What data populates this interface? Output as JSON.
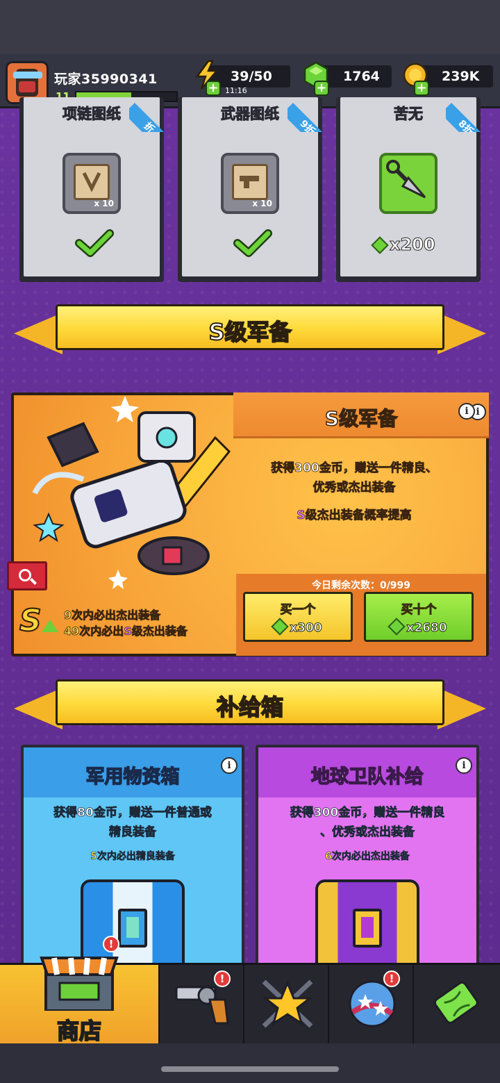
{
  "player": {
    "name": "玩家35990341",
    "level": "11",
    "xp_fraction": 0.55
  },
  "resources": {
    "energy": "39/50",
    "energy_timer": "11:16",
    "gems": "1764",
    "coins": "239K"
  },
  "offers": [
    {
      "title": "项链图纸",
      "qty": "x 10",
      "status": "purchased",
      "discount": "折"
    },
    {
      "title": "武器图纸",
      "qty": "x 10",
      "status": "purchased",
      "discount": "9折"
    },
    {
      "title": "苦无",
      "price": "x200",
      "status": "available",
      "discount": "8折"
    }
  ],
  "s_gear": {
    "banner": "S级军备",
    "title": "S级军备",
    "desc_line1_prefix": "获得300金币，赠送一件",
    "desc_line1_hl": "精良",
    "desc_line1_suffix": "、",
    "desc_line2_hl1": "优秀",
    "desc_line2_mid": "或",
    "desc_line2_hl2": "杰出",
    "desc_line2_suffix": "装备",
    "rate_hl": "S级杰出",
    "rate_suffix": "装备概率提高",
    "remaining": "今日剩余次数：0/999",
    "buy_one_label": "买一个",
    "buy_one_price": "x300",
    "buy_ten_label": "买十个",
    "buy_ten_price": "x2680",
    "pity1_num": "9",
    "pity1_mid": "次内必出",
    "pity1_hl": "杰出",
    "pity1_suffix": "装备",
    "pity2_num": "49",
    "pity2_mid": "次内必出",
    "pity2_hl": "S级杰出",
    "pity2_suffix": "装备",
    "badge": "S"
  },
  "supply": {
    "banner": "补给箱",
    "boxes": [
      {
        "title": "军用物资箱",
        "desc_prefix": "获得80金币，赠送一件普通或",
        "desc_hl": "精良",
        "desc_suffix": "装备",
        "pity_num": "5",
        "pity_mid": "次内必出",
        "pity_hl": "精良",
        "pity_suffix": "装备"
      },
      {
        "title": "地球卫队补给",
        "desc_prefix": "获得300金币，赠送一件",
        "desc_hl1": "精良",
        "desc_mid": "、",
        "desc_hl2": "优秀",
        "desc_mid2": "或",
        "desc_hl3": "杰出",
        "desc_suffix": "装备",
        "pity_num": "6",
        "pity_mid": "次内必出",
        "pity_hl": "杰出",
        "pity_suffix": "装备"
      }
    ]
  },
  "nav": {
    "tabs": [
      {
        "label": "商店",
        "icon": "shop-stall-icon",
        "active": true,
        "alert": true
      },
      {
        "label": "",
        "icon": "revolver-icon",
        "active": false,
        "alert": true
      },
      {
        "label": "",
        "icon": "star-swords-icon",
        "active": false,
        "alert": false
      },
      {
        "label": "",
        "icon": "planet-stars-icon",
        "active": false,
        "alert": true
      },
      {
        "label": "",
        "icon": "dna-capsule-icon",
        "active": false,
        "alert": false
      }
    ],
    "alert_symbol": "!"
  },
  "colors": {
    "accent_yellow": "#ffd93a",
    "gem_green": "#6cd43a",
    "energy_yellow": "#f4c42a",
    "rare_purple": "#e879ff",
    "good_green": "#9aff5a",
    "excellent_blue": "#6ad0ff"
  }
}
